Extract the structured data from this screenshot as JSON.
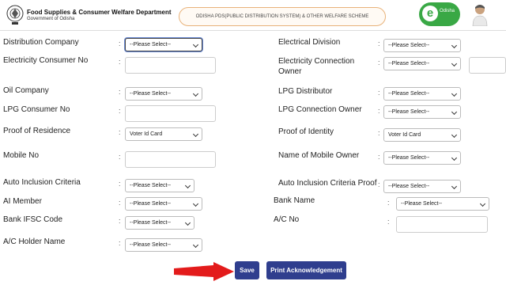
{
  "header": {
    "department": "Food Supplies & Consumer Welfare Department",
    "government": "Government of Odisha",
    "scheme": "ODISHA PDS(PUBLIC DISTRIBUTION SYSTEM) & OTHER WELFARE SCHEME",
    "logo_letter": "e",
    "logo_text": "Odisha"
  },
  "colon": ":",
  "labels": {
    "distribution_company": "Distribution Company",
    "electricity_consumer_no": "Electricity Consumer No",
    "oil_company": "Oil Company",
    "lpg_consumer_no": "LPG Consumer No",
    "proof_of_residence": "Proof of Residence",
    "mobile_no": "Mobile No",
    "auto_inclusion_criteria": "Auto Inclusion Criteria",
    "ai_member": "AI Member",
    "bank_ifsc_code": "Bank IFSC Code",
    "ac_holder_name": "A/C Holder Name",
    "electrical_division": "Electrical Division",
    "electricity_connection_owner_1": "Electricity Connection",
    "electricity_connection_owner_2": "Owner",
    "lpg_distributor": "LPG Distributor",
    "lpg_connection_owner": "LPG Connection Owner",
    "proof_of_identity": "Proof of Identity",
    "name_of_mobile_owner": "Name of Mobile Owner",
    "auto_inclusion_criteria_proof": "Auto Inclusion Criteria Proof",
    "bank_name": "Bank Name",
    "ac_no": "A/C No"
  },
  "values": {
    "please_select": "--Please Select--",
    "please_select_short": "--Please Select--",
    "voter_id_card": "Voter Id Card"
  },
  "buttons": {
    "save": "Save",
    "print": "Print Acknowledgement"
  },
  "colors": {
    "button": "#2f3e8e",
    "arrow": "#e31b1b"
  }
}
